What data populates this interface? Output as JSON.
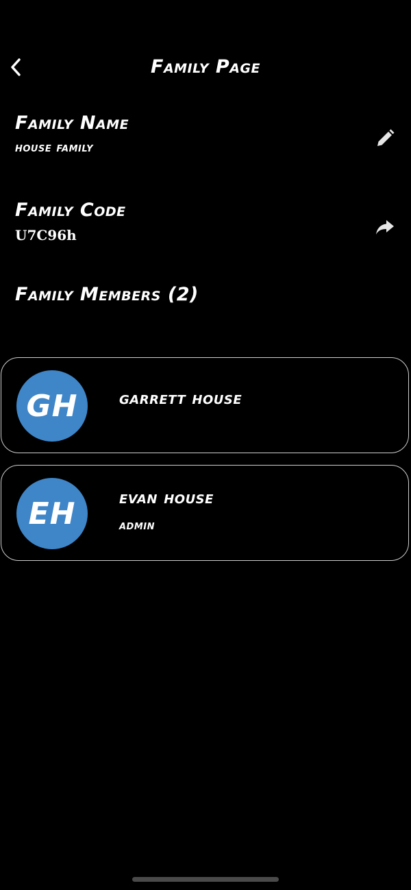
{
  "header": {
    "title": "Family Page",
    "back_icon": "chevron-left-icon"
  },
  "family_name": {
    "label": "Family Name",
    "value": "house family",
    "edit_icon": "pencil-icon"
  },
  "family_code": {
    "label": "Family Code",
    "value": "U7C96h",
    "share_icon": "share-arrow-icon"
  },
  "family_members": {
    "heading": "Family Members (2)",
    "members": [
      {
        "initials": "GH",
        "name": "garrett house",
        "role": ""
      },
      {
        "initials": "EH",
        "name": "evan house",
        "role": "admin"
      }
    ]
  },
  "colors": {
    "background": "#000000",
    "text": "#ffffff",
    "avatar": "#3f86c8",
    "card_border": "#cfcfcf"
  }
}
